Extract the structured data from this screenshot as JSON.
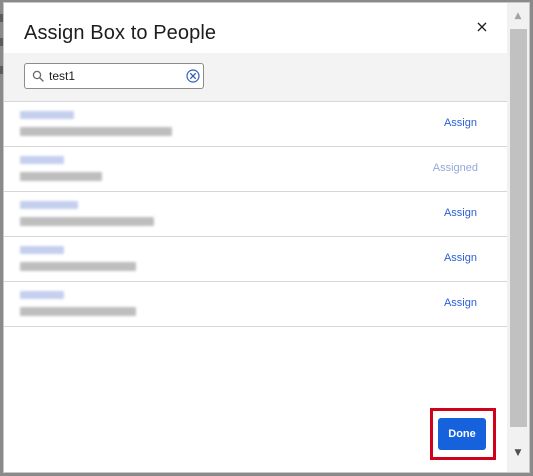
{
  "modal": {
    "title": "Assign Box to People",
    "close_label": "×"
  },
  "search": {
    "value": "test1",
    "placeholder": ""
  },
  "people": [
    {
      "action_label": "Assign",
      "assigned": false
    },
    {
      "action_label": "Assigned",
      "assigned": true
    },
    {
      "action_label": "Assign",
      "assigned": false
    },
    {
      "action_label": "Assign",
      "assigned": false
    },
    {
      "action_label": "Assign",
      "assigned": false
    }
  ],
  "footer": {
    "done_label": "Done"
  },
  "scrollbar": {
    "up_arrow": "▲",
    "down_arrow": "▼"
  },
  "colors": {
    "accent": "#1662dd",
    "link": "#2b5fd6",
    "assigned_link": "#93a9dc",
    "highlight": "#d0021b"
  }
}
